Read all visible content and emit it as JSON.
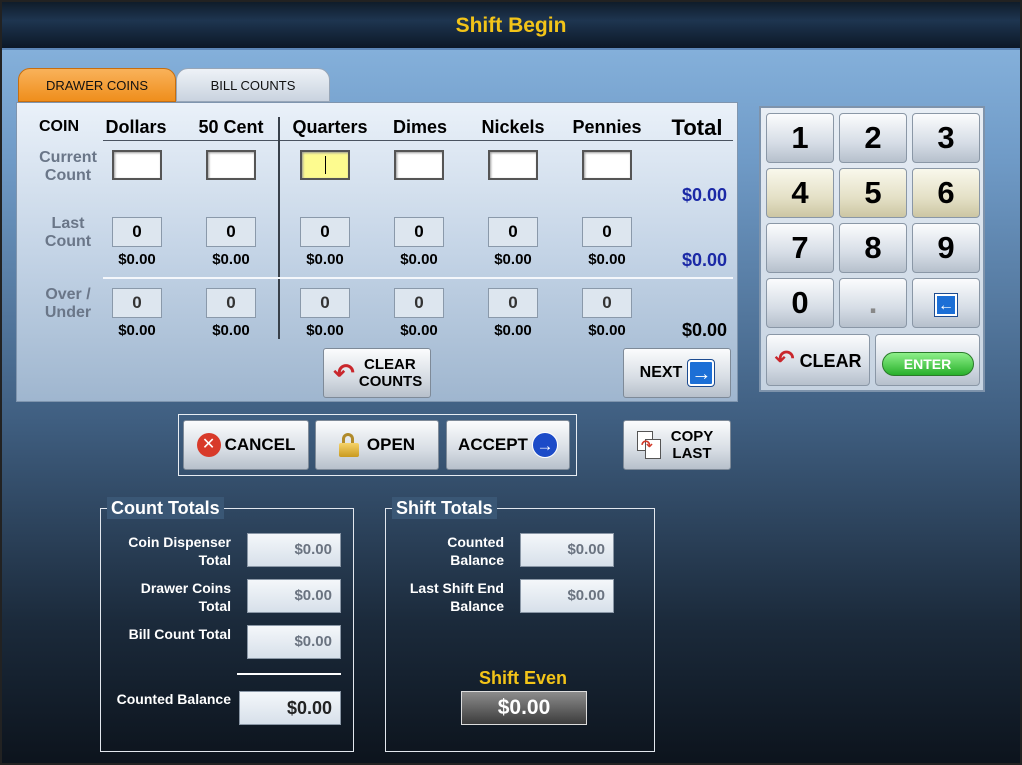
{
  "window": {
    "title": "Shift Begin"
  },
  "tabs": [
    {
      "label": "DRAWER COINS"
    },
    {
      "label": "BILL COUNTS"
    }
  ],
  "coin_table": {
    "coin_header": "COIN",
    "columns": [
      "Dollars",
      "50 Cent",
      "Quarters",
      "Dimes",
      "Nickels",
      "Pennies"
    ],
    "total_header": "Total",
    "row_labels": {
      "current": "Current Count",
      "last": "Last Count",
      "over": "Over / Under"
    },
    "current_total": "$0.00",
    "last_counts": [
      "0",
      "0",
      "0",
      "0",
      "0",
      "0"
    ],
    "last_amounts": [
      "$0.00",
      "$0.00",
      "$0.00",
      "$0.00",
      "$0.00",
      "$0.00"
    ],
    "last_total": "$0.00",
    "over_counts": [
      "0",
      "0",
      "0",
      "0",
      "0",
      "0"
    ],
    "over_amounts": [
      "$0.00",
      "$0.00",
      "$0.00",
      "$0.00",
      "$0.00",
      "$0.00"
    ],
    "over_total": "$0.00"
  },
  "buttons": {
    "clear_counts": "CLEAR COUNTS",
    "next": "NEXT",
    "cancel": "CANCEL",
    "open": "OPEN",
    "accept": "ACCEPT",
    "copy_last": "COPY LAST"
  },
  "keypad": {
    "keys": [
      "1",
      "2",
      "3",
      "4",
      "5",
      "6",
      "7",
      "8",
      "9",
      "0",
      "."
    ],
    "clear": "CLEAR",
    "enter": "ENTER"
  },
  "count_totals": {
    "title": "Count Totals",
    "fields": [
      {
        "label": "Coin Dispenser Total",
        "value": "$0.00"
      },
      {
        "label": "Drawer Coins Total",
        "value": "$0.00"
      },
      {
        "label": "Bill Count Total",
        "value": "$0.00"
      }
    ],
    "counted_balance_label": "Counted Balance",
    "counted_balance_value": "$0.00"
  },
  "shift_totals": {
    "title": "Shift Totals",
    "fields": [
      {
        "label": "Counted Balance",
        "value": "$0.00"
      },
      {
        "label": "Last Shift End Balance",
        "value": "$0.00"
      }
    ],
    "status_label": "Shift Even",
    "status_value": "$0.00"
  },
  "colors": {
    "title": "#f3c418",
    "active_tab": "#ef8e1c",
    "total_blue": "#1b29a6"
  }
}
